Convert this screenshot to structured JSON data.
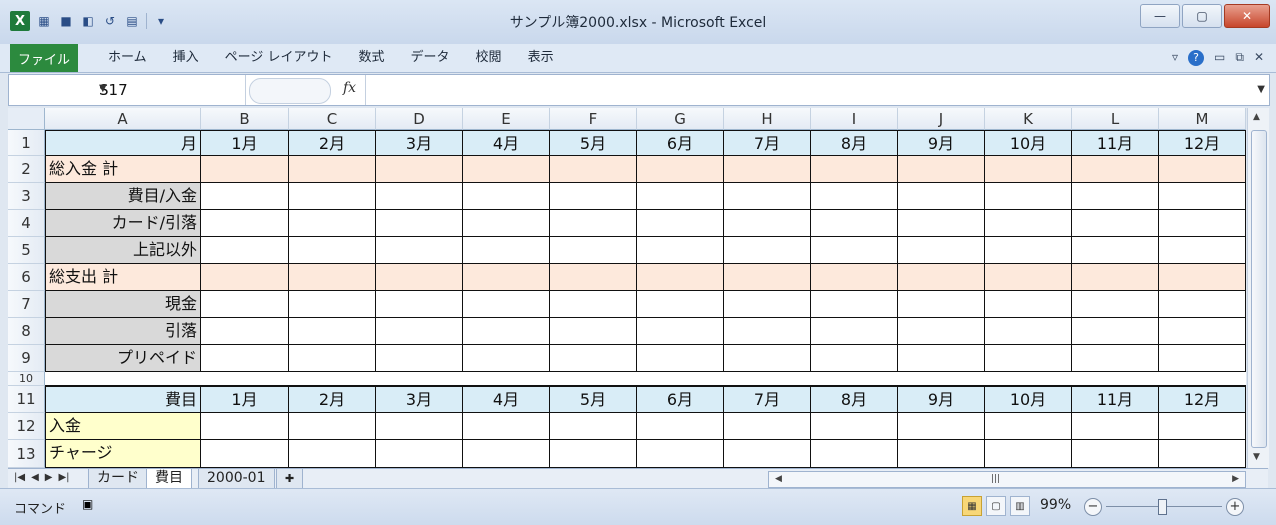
{
  "app": {
    "window_title": "サンプル簿2000.xlsx  -  Microsoft Excel"
  },
  "ribbon": {
    "file_tab": "ファイル",
    "tabs": [
      "ホーム",
      "挿入",
      "ページ レイアウト",
      "数式",
      "データ",
      "校閲",
      "表示"
    ]
  },
  "formula_bar": {
    "name_box": "S17",
    "fx_label": "fx",
    "formula": ""
  },
  "sheet": {
    "columns": [
      "A",
      "B",
      "C",
      "D",
      "E",
      "F",
      "G",
      "H",
      "I",
      "J",
      "K",
      "L",
      "M"
    ],
    "rows": [
      {
        "num": "1",
        "type": "hdr",
        "a": "月",
        "values": [
          "1月",
          "2月",
          "3月",
          "4月",
          "5月",
          "6月",
          "7月",
          "8月",
          "9月",
          "10月",
          "11月",
          "12月"
        ]
      },
      {
        "num": "2",
        "type": "pink",
        "a": "総入金 計",
        "values": [
          "",
          "",
          "",
          "",
          "",
          "",
          "",
          "",
          "",
          "",
          "",
          ""
        ]
      },
      {
        "num": "3",
        "type": "gray",
        "a": "費目/入金",
        "values": [
          "",
          "",
          "",
          "",
          "",
          "",
          "",
          "",
          "",
          "",
          "",
          ""
        ]
      },
      {
        "num": "4",
        "type": "gray",
        "a": "カード/引落",
        "values": [
          "",
          "",
          "",
          "",
          "",
          "",
          "",
          "",
          "",
          "",
          "",
          ""
        ]
      },
      {
        "num": "5",
        "type": "gray",
        "a": "上記以外",
        "values": [
          "",
          "",
          "",
          "",
          "",
          "",
          "",
          "",
          "",
          "",
          "",
          ""
        ]
      },
      {
        "num": "6",
        "type": "pink",
        "a": "総支出 計",
        "values": [
          "",
          "",
          "",
          "",
          "",
          "",
          "",
          "",
          "",
          "",
          "",
          ""
        ]
      },
      {
        "num": "7",
        "type": "gray",
        "a": "現金",
        "values": [
          "",
          "",
          "",
          "",
          "",
          "",
          "",
          "",
          "",
          "",
          "",
          ""
        ]
      },
      {
        "num": "8",
        "type": "gray",
        "a": "引落",
        "values": [
          "",
          "",
          "",
          "",
          "",
          "",
          "",
          "",
          "",
          "",
          "",
          ""
        ]
      },
      {
        "num": "9",
        "type": "gray",
        "a": "プリペイド",
        "values": [
          "",
          "",
          "",
          "",
          "",
          "",
          "",
          "",
          "",
          "",
          "",
          ""
        ]
      },
      {
        "num": "10",
        "type": "blank",
        "a": "",
        "values": []
      },
      {
        "num": "11",
        "type": "hdr",
        "a": "費目",
        "values": [
          "1月",
          "2月",
          "3月",
          "4月",
          "5月",
          "6月",
          "7月",
          "8月",
          "9月",
          "10月",
          "11月",
          "12月"
        ]
      },
      {
        "num": "12",
        "type": "yellow",
        "a": "入金",
        "values": [
          "",
          "",
          "",
          "",
          "",
          "",
          "",
          "",
          "",
          "",
          "",
          ""
        ]
      },
      {
        "num": "13",
        "type": "yellow",
        "a": "チャージ",
        "values": [
          "",
          "",
          "",
          "",
          "",
          "",
          "",
          "",
          "",
          "",
          "",
          ""
        ]
      }
    ]
  },
  "sheet_tabs": [
    "カード",
    "費目",
    "2000-01"
  ],
  "active_sheet": "費目",
  "status": {
    "mode": "コマンド",
    "zoom": "99%"
  }
}
